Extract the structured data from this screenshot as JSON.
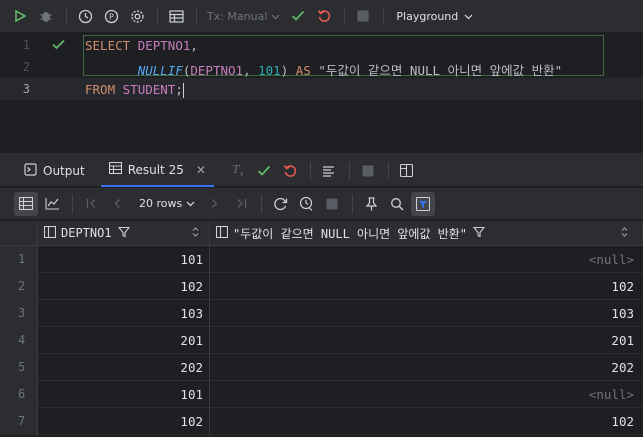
{
  "toolbar": {
    "tx_mode": "Tx: Manual",
    "schema": "Playground"
  },
  "editor": {
    "line_numbers": [
      "1",
      "2",
      "3"
    ],
    "line1": {
      "kw": "SELECT",
      "col": "DEPTNO1",
      "punct": ","
    },
    "line2": {
      "fn": "NULLIF",
      "open": "(",
      "col": "DEPTNO1",
      "comma": ", ",
      "num": "101",
      "close": ")",
      "as": "AS",
      "alias": "\"두값이 같으면 NULL 아니면 앞에값 반환\""
    },
    "line3": {
      "kw": "FROM",
      "table": "STUDENT",
      "semi": ";"
    }
  },
  "results": {
    "tabs": {
      "output": "Output",
      "result": "Result 25"
    },
    "rows_label": "20 rows",
    "columns": [
      "DEPTNO1",
      "\"두값이 같으면 NULL 아니면 앞에값 반환\""
    ],
    "rows": [
      {
        "n": "1",
        "c1": "101",
        "c2": "<null>"
      },
      {
        "n": "2",
        "c1": "102",
        "c2": "102"
      },
      {
        "n": "3",
        "c1": "103",
        "c2": "103"
      },
      {
        "n": "4",
        "c1": "201",
        "c2": "201"
      },
      {
        "n": "5",
        "c1": "202",
        "c2": "202"
      },
      {
        "n": "6",
        "c1": "101",
        "c2": "<null>"
      },
      {
        "n": "7",
        "c1": "102",
        "c2": "102"
      }
    ]
  },
  "colors": {
    "accent": "#3574f0",
    "success": "#5fb865",
    "danger": "#e55b52"
  }
}
